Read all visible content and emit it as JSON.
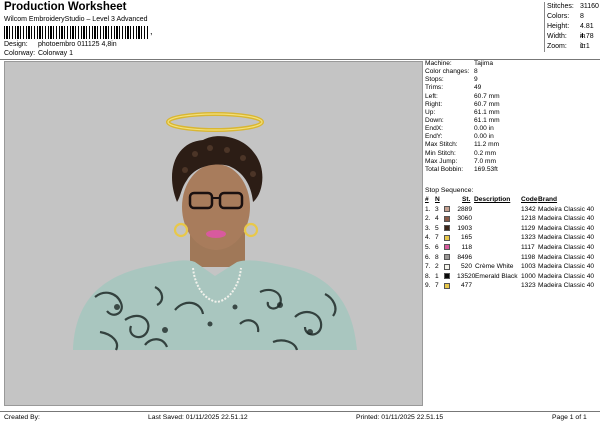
{
  "header": {
    "title": "Production Worksheet",
    "subtitle": "Wilcom EmbroideryStudio – Level 3 Advanced",
    "barcode_tail": ","
  },
  "meta": {
    "design_label": "Design:",
    "design_value": "photoembro 011125 4,8in",
    "colorway_label": "Colorway:",
    "colorway_value": "Colorway 1"
  },
  "stats": [
    {
      "label": "Stitches:",
      "value": "31160"
    },
    {
      "label": "Colors:",
      "value": "8"
    },
    {
      "label": "Height:",
      "value": "4.81 in"
    },
    {
      "label": "Width:",
      "value": "4.78 in"
    },
    {
      "label": "Zoom:",
      "value": "1:1"
    }
  ],
  "machine_info": [
    {
      "label": "Machine:",
      "value": "Tajima"
    },
    {
      "label": "Color changes:",
      "value": "8"
    },
    {
      "label": "Stops:",
      "value": "9"
    },
    {
      "label": "Trims:",
      "value": "49"
    },
    {
      "label": "Left:",
      "value": "60.7 mm"
    },
    {
      "label": "Right:",
      "value": "60.7 mm"
    },
    {
      "label": "Up:",
      "value": "61.1 mm"
    },
    {
      "label": "Down:",
      "value": "61.1 mm"
    },
    {
      "label": "EndX:",
      "value": "0.00 in"
    },
    {
      "label": "EndY:",
      "value": "0.00 in"
    },
    {
      "label": "Max Stitch:",
      "value": "11.2 mm"
    },
    {
      "label": "Min Stitch:",
      "value": "0.2 mm"
    },
    {
      "label": "Max Jump:",
      "value": "7.0 mm"
    },
    {
      "label": "Total Bobbin:",
      "value": "169.53ft"
    }
  ],
  "stop_sequence": {
    "title": "Stop Sequence:",
    "columns": {
      "num": "#",
      "n": "N",
      "st": "St.",
      "description": "Description",
      "code": "Code",
      "brand": "Brand"
    },
    "rows": [
      {
        "num": "1.",
        "n": "3",
        "color": "#c4a090",
        "st": "2889",
        "desc": "",
        "code": "1342",
        "brand": "Madeira Classic 40"
      },
      {
        "num": "2.",
        "n": "4",
        "color": "#8a5a48",
        "st": "3060",
        "desc": "",
        "code": "1218",
        "brand": "Madeira Classic 40"
      },
      {
        "num": "3.",
        "n": "5",
        "color": "#3a2418",
        "st": "1903",
        "desc": "",
        "code": "1129",
        "brand": "Madeira Classic 40"
      },
      {
        "num": "4.",
        "n": "7",
        "color": "#e8c84a",
        "st": "165",
        "desc": "",
        "code": "1323",
        "brand": "Madeira Classic 40"
      },
      {
        "num": "5.",
        "n": "6",
        "color": "#d85a9e",
        "st": "118",
        "desc": "",
        "code": "1117",
        "brand": "Madeira Classic 40"
      },
      {
        "num": "6.",
        "n": "8",
        "color": "#9c9a98",
        "st": "8496",
        "desc": "",
        "code": "1198",
        "brand": "Madeira Classic 40"
      },
      {
        "num": "7.",
        "n": "2",
        "color": "#f4f4ec",
        "st": "520",
        "desc": "Crème White",
        "code": "1003",
        "brand": "Madeira Classic 40"
      },
      {
        "num": "8.",
        "n": "1",
        "color": "#0a0a0a",
        "st": "13520",
        "desc": "Emerald Black",
        "code": "1000",
        "brand": "Madeira Classic 40"
      },
      {
        "num": "9.",
        "n": "7",
        "color": "#e8c84a",
        "st": "477",
        "desc": "",
        "code": "1323",
        "brand": "Madeira Classic 40"
      }
    ]
  },
  "footer": {
    "created_by": "Created By:",
    "last_saved": "Last Saved: 01/11/2025 22.51.12",
    "printed": "Printed: 01/11/2025 22.51.15",
    "page": "Page 1 of 1"
  }
}
